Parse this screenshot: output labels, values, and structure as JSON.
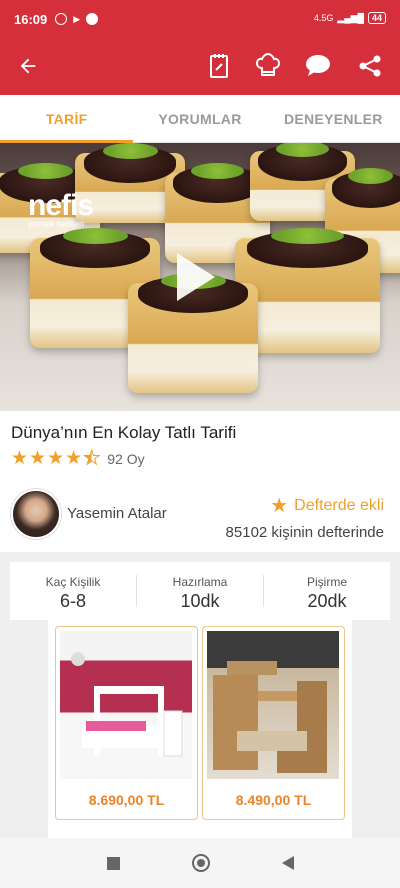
{
  "status": {
    "time": "16:09",
    "battery": "44",
    "net": "4.5G"
  },
  "appbar": {
    "icons": [
      "back-arrow-icon",
      "notebook-icon",
      "chef-hat-icon",
      "comment-icon",
      "share-icon"
    ]
  },
  "tabs": [
    {
      "label": "TARİF",
      "active": true
    },
    {
      "label": "YORUMLAR",
      "active": false
    },
    {
      "label": "DENEYENLER",
      "active": false
    }
  ],
  "hero": {
    "logo": "nefis",
    "logo_sub": "yemek tarifleri"
  },
  "recipe": {
    "title": "Dünya’nın En Kolay Tatlı Tarifi",
    "rating": 4.5,
    "votes": "92 Oy",
    "author": "Yasemin Atalar",
    "favorite_label": "Defterde ekli",
    "favorite_count": "85102 kişinin defterinde"
  },
  "stats": [
    {
      "label": "Kaç Kişilik",
      "value": "6-8"
    },
    {
      "label": "Hazırlama",
      "value": "10dk"
    },
    {
      "label": "Pişirme",
      "value": "20dk"
    }
  ],
  "ad": {
    "products": [
      {
        "price": "8.690,00 TL"
      },
      {
        "price": "8.490,00 TL"
      }
    ]
  },
  "colors": {
    "brand": "#d62f3c",
    "accent": "#f19f2b",
    "price": "#e9842a"
  }
}
